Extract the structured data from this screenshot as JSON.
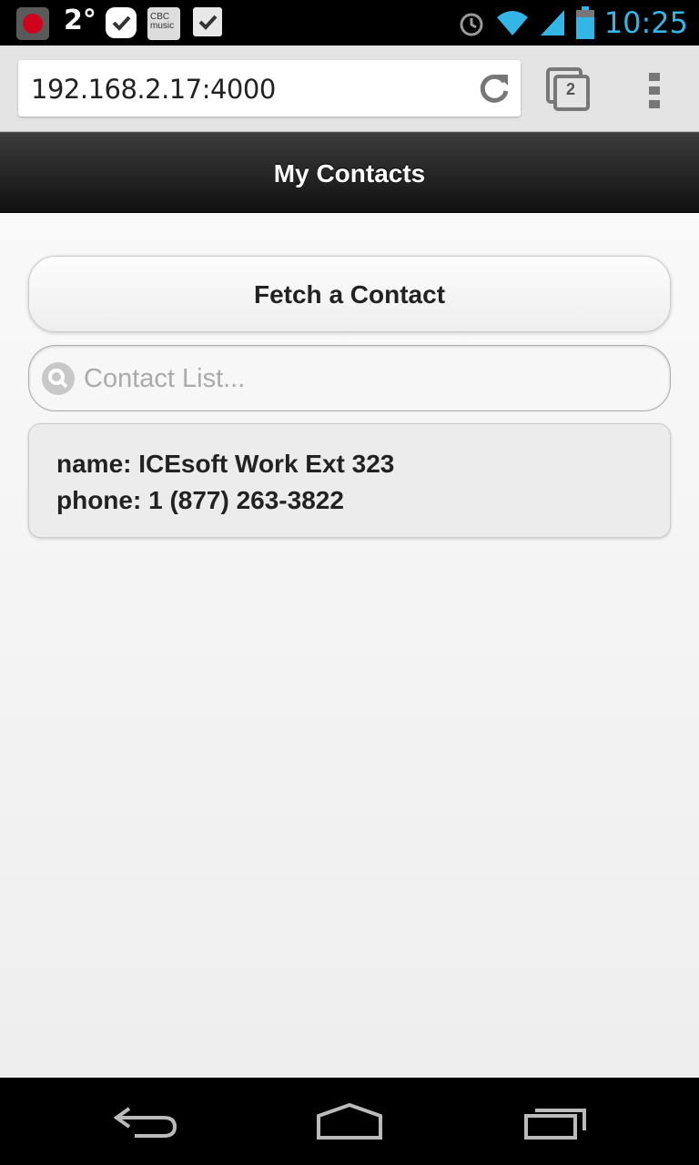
{
  "status_bar": {
    "temperature": "2°",
    "music_app_label": "CBC music",
    "time": "10:25",
    "notification_icons": [
      "cbc-app-icon",
      "check-circle-icon",
      "cbc-music-icon",
      "shopping-bag-icon"
    ],
    "system_icons": [
      "alarm-icon",
      "wifi-icon",
      "signal-icon",
      "battery-icon"
    ]
  },
  "browser": {
    "url": "192.168.2.17:4000",
    "tab_count": "2"
  },
  "header": {
    "title": "My Contacts"
  },
  "main": {
    "fetch_button_label": "Fetch a Contact",
    "search_placeholder": "Contact List...",
    "contact": {
      "name_line": "name: ICEsoft Work Ext 323",
      "phone_line": "phone: 1 (877) 263-3822"
    }
  },
  "colors": {
    "time_accent": "#33b5e5",
    "header_bg": "#1c1c1c",
    "page_bg": "#f4f4f4"
  }
}
